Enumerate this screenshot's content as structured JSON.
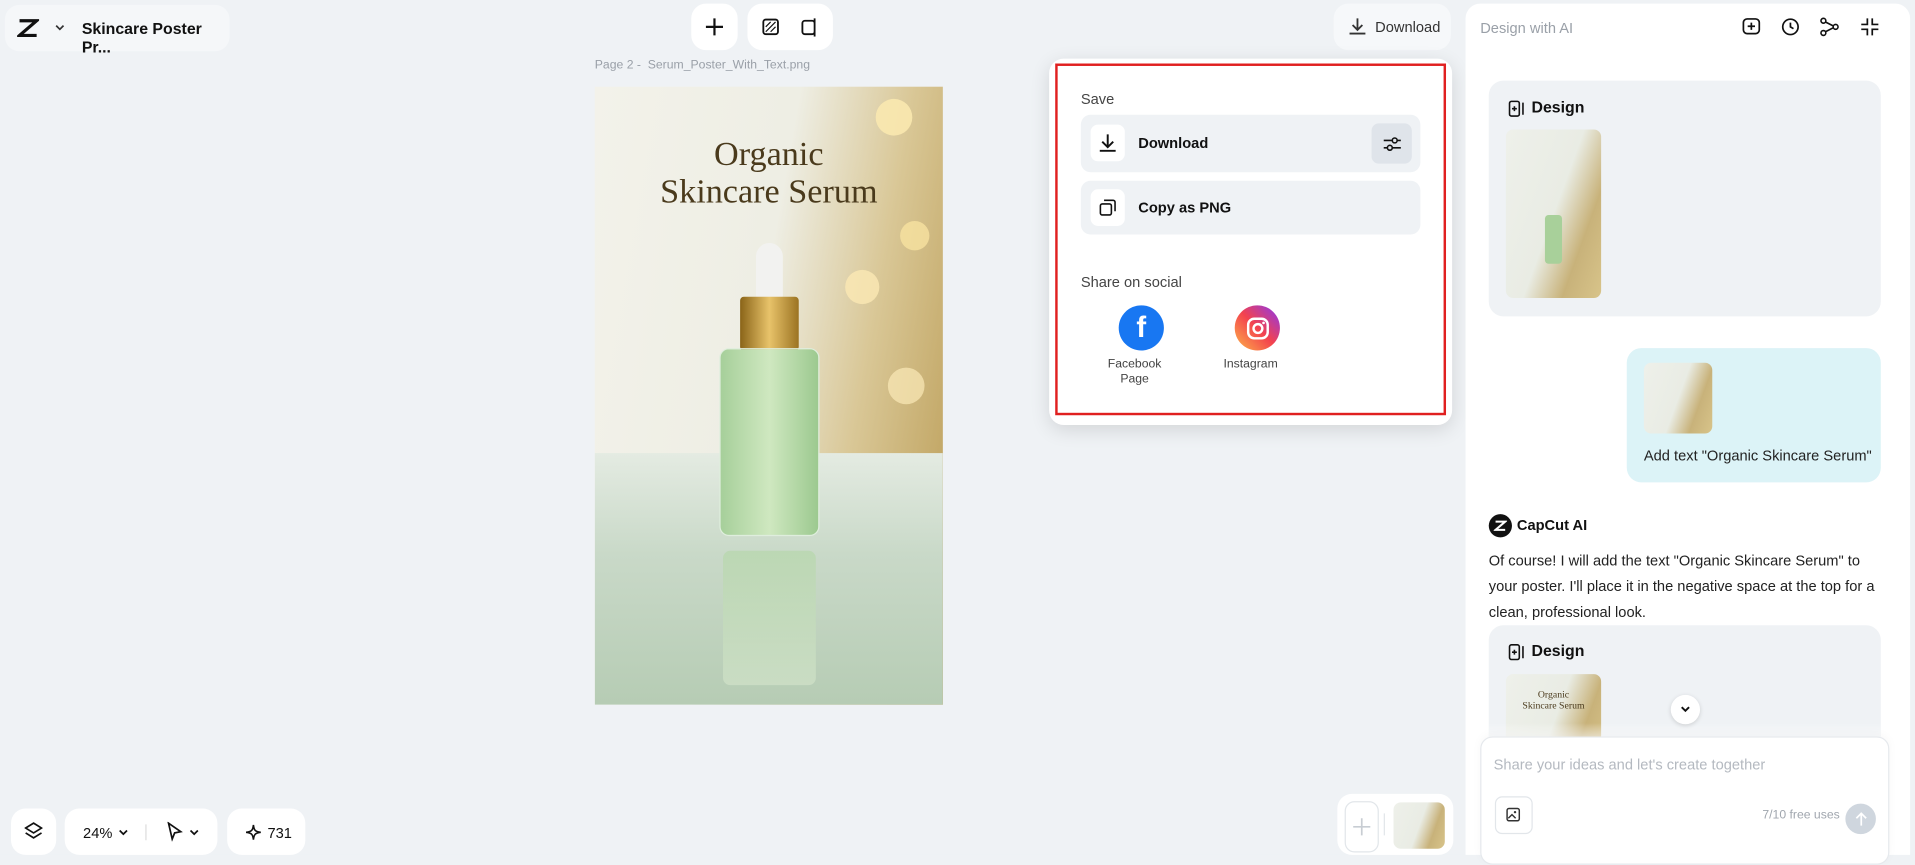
{
  "header": {
    "project_title": "Skincare Poster Pr...",
    "download_label": "Download"
  },
  "canvas": {
    "page_label": "Page 2 -",
    "file_name": "Serum_Poster_With_Text.png",
    "poster_title_line1": "Organic",
    "poster_title_line2": "Skincare Serum"
  },
  "download_menu": {
    "save_heading": "Save",
    "download_label": "Download",
    "copy_label": "Copy as PNG",
    "share_heading": "Share on social",
    "facebook_label_line1": "Facebook",
    "facebook_label_line2": "Page",
    "instagram_label": "Instagram",
    "highlight_color": "#e02020"
  },
  "bottom_bar": {
    "zoom_level": "24%",
    "credits": "731"
  },
  "ai_panel": {
    "title": "Design with AI",
    "design_label_1": "Design",
    "user_message": "Add text \"Organic Skincare Serum\"",
    "assistant_name": "CapCut AI",
    "assistant_message": "Of course! I will add the text \"Organic Skincare Serum\" to your poster. I'll place it in the negative space at the top for a clean, professional look.",
    "design_label_2": "Design",
    "thumb_title_line1": "Organic",
    "thumb_title_line2": "Skincare Serum",
    "input_placeholder": "Share your ideas and let's create together",
    "usage": "7/10 free uses",
    "user_bubble_color": "#dcf3f7"
  }
}
